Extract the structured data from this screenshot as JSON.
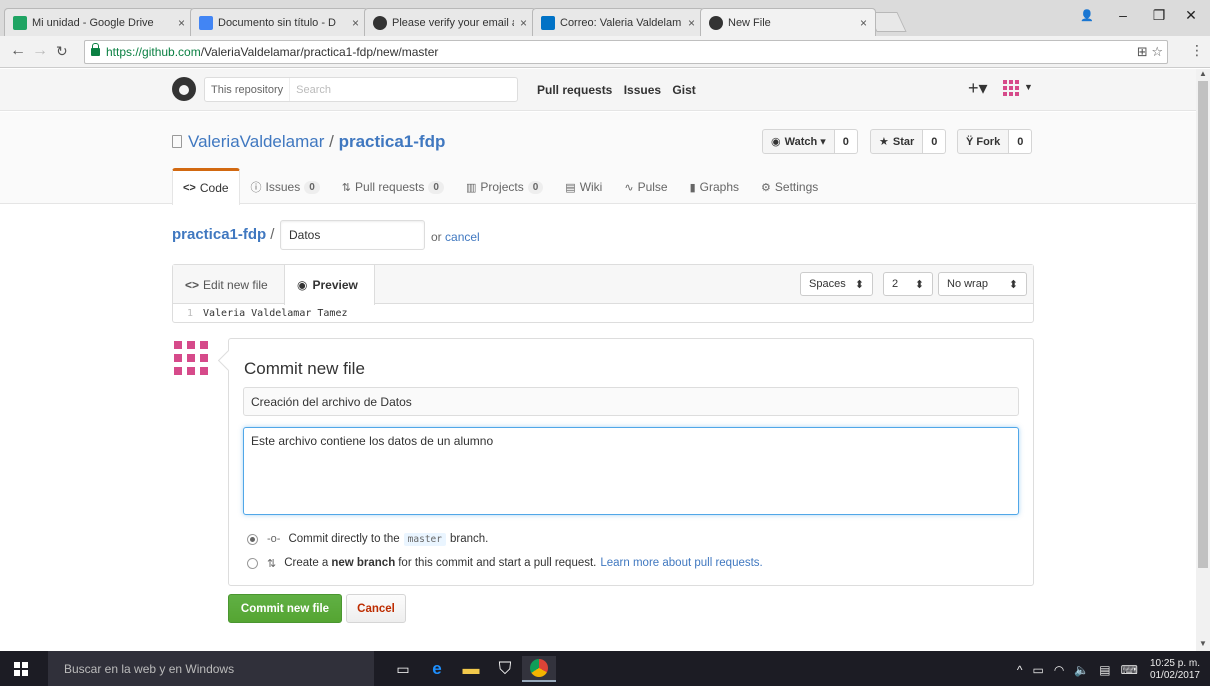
{
  "browser": {
    "tabs": [
      {
        "label": "Mi unidad - Google Drive",
        "close": "×",
        "color": "#1fa463"
      },
      {
        "label": "Documento sin título - D",
        "close": "×",
        "color": "#4285f4"
      },
      {
        "label": "Please verify your email a",
        "close": "×",
        "color": "#333333"
      },
      {
        "label": "Correo: Valeria Valdelam",
        "close": "×",
        "color": "#0072c6"
      },
      {
        "label": "New File",
        "close": "×",
        "color": "#333333"
      }
    ],
    "url_host": "https://github.com",
    "url_path": "/ValeriaValdelamar/practica1-fdp/new/master"
  },
  "github_header": {
    "search_scope": "This repository",
    "search_placeholder": "Search",
    "nav": [
      "Pull requests",
      "Issues",
      "Gist"
    ],
    "plus": "+▾"
  },
  "repo": {
    "owner": "ValeriaValdelamar",
    "separator": "/",
    "name": "practica1-fdp",
    "watch_label": "Watch ▾",
    "watch_count": "0",
    "star_label": "Star",
    "star_count": "0",
    "fork_label": "Fork",
    "fork_count": "0",
    "tabs": [
      {
        "label": "Code",
        "count": ""
      },
      {
        "label": "Issues",
        "count": "0"
      },
      {
        "label": "Pull requests",
        "count": "0"
      },
      {
        "label": "Projects",
        "count": "0"
      },
      {
        "label": "Wiki",
        "count": ""
      },
      {
        "label": "Pulse",
        "count": ""
      },
      {
        "label": "Graphs",
        "count": ""
      },
      {
        "label": "Settings",
        "count": ""
      }
    ]
  },
  "editor": {
    "crumb_repo": "practica1-fdp",
    "crumb_slash": "/",
    "filename": "Datos",
    "or_text": "or",
    "cancel_link": "cancel",
    "tab_edit": "Edit new file",
    "tab_preview": "Preview",
    "indent_mode": "Spaces",
    "indent_size": "2",
    "wrap_mode": "No wrap",
    "line_number": "1",
    "line_content": "Valeria Valdelamar Tamez"
  },
  "commit": {
    "heading": "Commit new file",
    "summary": "Creación del archivo de Datos",
    "description": "Este archivo contiene los datos de un alumno",
    "option1_pre": "Commit directly to the",
    "option1_branch": "master",
    "option1_post": "branch.",
    "option2_pre": "Create a",
    "option2_bold": "new branch",
    "option2_mid": "for this commit and start a pull request.",
    "option2_link": "Learn more about pull requests.",
    "submit_label": "Commit new file",
    "cancel_label": "Cancel"
  },
  "taskbar": {
    "search_text": "Buscar en la web y en Windows",
    "time": "10:25 p. m.",
    "date": "01/02/2017"
  }
}
